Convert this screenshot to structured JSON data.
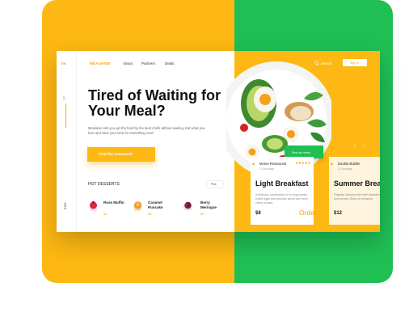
{
  "rail": {
    "lang_code": "EN",
    "label": "1/4",
    "bottom_text": "ENG"
  },
  "header": {
    "logo": "MEALWISE",
    "nav": [
      "About",
      "Partners",
      "Deals"
    ],
    "search_label": "Search",
    "signin_label": "Sign in"
  },
  "hero": {
    "title": "Tired of Waiting for Your Meal?",
    "description": "Mealwise lets you get the food by the best chefs without waiting. Eat what you love and save your time for something cool!",
    "cta_label": "Find the restaurant"
  },
  "desserts": {
    "heading": "HOT DESSERTS:",
    "pick_label": "Pick",
    "items": [
      {
        "name": "Rose Muffin",
        "price": "$4",
        "color": "#d9293b"
      },
      {
        "name": "Caramel Puncake",
        "price": "$5",
        "color": "#e9a13b"
      },
      {
        "name": "Berry Meringue",
        "price": "$3",
        "color": "#7a1d3a"
      }
    ]
  },
  "menu": {
    "see_all_label": "See all menu",
    "prev_icon": "chevron-left-icon",
    "next_icon": "chevron-right-icon"
  },
  "cards": [
    {
      "restaurant": "Monet Restaurant",
      "distance": "1,4 km away",
      "stars": "★★★★★",
      "title": "Light Breakfast",
      "description": "A delicious combination of a crispy toasts, boiled eggs and avocado slices with fresh cherry tomato",
      "price": "$8",
      "order_label": "Order"
    },
    {
      "restaurant": "Double Bubble",
      "distance": "2,3 km away",
      "stars": "",
      "title": "Summer Breakfast",
      "description": "Fragrant oatmeal with fresh strawberry and currant. Spice of cinnamon",
      "price": "$12",
      "order_label": ""
    }
  ],
  "colors": {
    "accent": "#fdb813",
    "accent_text": "#f6a400",
    "green": "#1fbf54",
    "card_bg": "#ffffff"
  }
}
